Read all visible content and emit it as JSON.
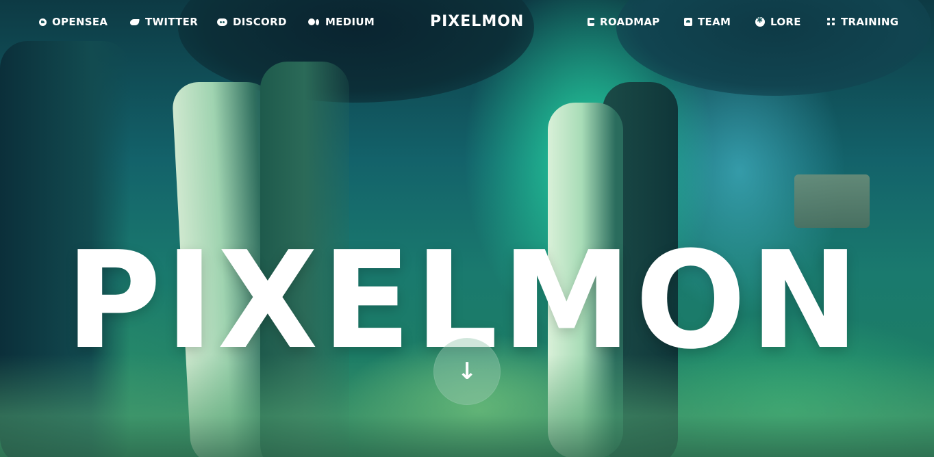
{
  "nav": {
    "left": [
      {
        "label": "OPENSEA",
        "icon": "opensea-icon"
      },
      {
        "label": "TWITTER",
        "icon": "twitter-icon"
      },
      {
        "label": "DISCORD",
        "icon": "discord-icon"
      },
      {
        "label": "MEDIUM",
        "icon": "medium-icon"
      }
    ],
    "logo": "PIXELMON",
    "right": [
      {
        "label": "ROADMAP",
        "icon": "roadmap-icon"
      },
      {
        "label": "TEAM",
        "icon": "team-icon"
      },
      {
        "label": "LORE",
        "icon": "lore-icon"
      },
      {
        "label": "TRAINING",
        "icon": "training-icon"
      }
    ]
  },
  "hero": {
    "title": "PIXELMON",
    "scroll_arrow": "↓"
  },
  "colors": {
    "text": "#ffffff",
    "scroll_button": "#96c8af"
  }
}
